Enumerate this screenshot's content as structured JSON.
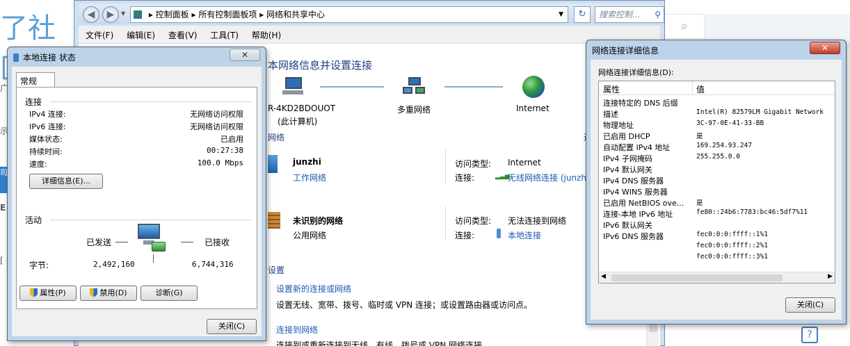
{
  "background": {
    "banner_text": "了社区",
    "left_clips": [
      "广",
      "示",
      "司",
      "E",
      "["
    ]
  },
  "control_panel": {
    "address_segments": [
      "控制面板",
      "所有控制面板项",
      "网络和共享中心"
    ],
    "search_placeholder": "搜索控制...",
    "menu": [
      "文件(F)",
      "编辑(E)",
      "查看(V)",
      "工具(T)",
      "帮助(H)"
    ],
    "heading": "本网络信息并设置连接",
    "map_nodes": [
      {
        "name": "R-4KD2BDOUOT",
        "sub": "(此计算机)"
      },
      {
        "name": "多重网络",
        "sub": ""
      },
      {
        "name": "Internet",
        "sub": ""
      }
    ],
    "network_section_label": "网络",
    "network_section_link": "连",
    "networks": [
      {
        "name": "junzhi",
        "type": "工作网络",
        "access_label": "访问类型:",
        "access": "Internet",
        "conn_label": "连接:",
        "conn": "无线网络连接 (junzhi)"
      },
      {
        "name": "未识别的网络",
        "type": "公用网络",
        "access_label": "访问类型:",
        "access": "无法连接到网络",
        "conn_label": "连接:",
        "conn": "本地连接"
      }
    ],
    "settings_label": "设置",
    "tasks": [
      {
        "link": "设置新的连接或网络",
        "desc": "设置无线、宽带、拨号、临时或 VPN 连接；或设置路由器或访问点。"
      },
      {
        "link": "连接到网络",
        "desc": "连接到或重新连接到无线、有线、拨号或 VPN 网络连接。"
      }
    ]
  },
  "local_status": {
    "title": "本地连接 状态",
    "close_glyph": "✕",
    "tab": "常规",
    "connection_label": "连接",
    "rows": [
      {
        "k": "IPv4 连接:",
        "v": "无网络访问权限"
      },
      {
        "k": "IPv6 连接:",
        "v": "无网络访问权限"
      },
      {
        "k": "媒体状态:",
        "v": "已启用"
      },
      {
        "k": "持续时间:",
        "v": "00:27:38"
      },
      {
        "k": "速度:",
        "v": "100.0 Mbps"
      }
    ],
    "details_button": "详细信息(E)...",
    "activity_label": "活动",
    "sent_label": "已发送",
    "received_label": "已接收",
    "bytes_label": "字节:",
    "bytes_sent": "2,492,160",
    "bytes_received": "6,744,316",
    "properties_button": "属性(P)",
    "disable_button": "禁用(D)",
    "diagnose_button": "诊断(G)",
    "close_button": "关闭(C)"
  },
  "details": {
    "title": "网络连接详细信息",
    "label": "网络连接详细信息(D):",
    "col_property": "属性",
    "col_value": "值",
    "rows": [
      {
        "p": "连接特定的 DNS 后缀",
        "v": ""
      },
      {
        "p": "描述",
        "v": "Intel(R) 82579LM Gigabit Network"
      },
      {
        "p": "物理地址",
        "v": "3C-97-0E-41-33-BB"
      },
      {
        "p": "已启用 DHCP",
        "v": "是"
      },
      {
        "p": "自动配置 IPv4 地址",
        "v": "169.254.93.247"
      },
      {
        "p": "IPv4 子网掩码",
        "v": "255.255.0.0"
      },
      {
        "p": "IPv4 默认网关",
        "v": ""
      },
      {
        "p": "IPv4 DNS 服务器",
        "v": ""
      },
      {
        "p": "IPv4 WINS 服务器",
        "v": ""
      },
      {
        "p": "已启用 NetBIOS ove...",
        "v": "是"
      },
      {
        "p": "连接-本地 IPv6 地址",
        "v": "fe80::24b6:7783:bc46:5df7%11"
      },
      {
        "p": "IPv6 默认网关",
        "v": ""
      },
      {
        "p": "IPv6 DNS 服务器",
        "v": "fec0:0:0:ffff::1%1"
      },
      {
        "p": "",
        "v": "fec0:0:0:ffff::2%1"
      },
      {
        "p": "",
        "v": "fec0:0:0:ffff::3%1"
      }
    ],
    "close_button": "关闭(C)"
  }
}
